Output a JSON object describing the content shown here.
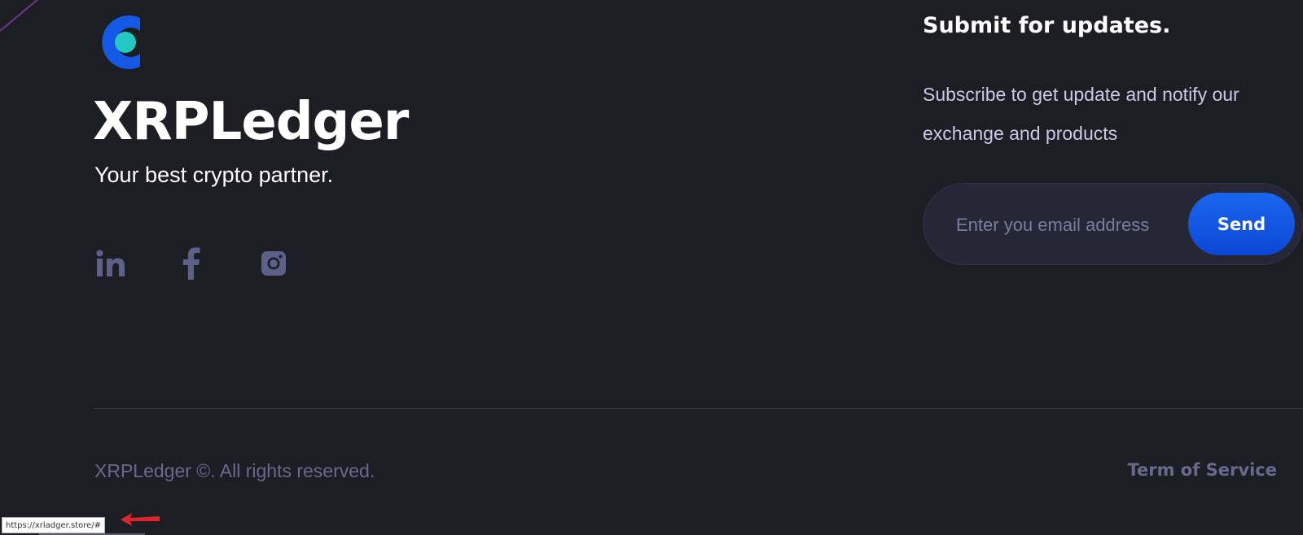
{
  "colors": {
    "background": "#1d1d24",
    "logo_outer": "#1458e6",
    "logo_inner": "#23c9c0",
    "accent_button": "#1a5ee8",
    "social_icon": "#5d6088",
    "muted_text": "#676a8c",
    "annotation_arrow": "#e0242b"
  },
  "brand": {
    "logo_icon": "brand-logo-icon",
    "name": "XRPLedger",
    "tagline": "Your best crypto partner."
  },
  "social": [
    {
      "name": "linkedin",
      "icon": "linkedin-icon"
    },
    {
      "name": "facebook",
      "icon": "facebook-icon"
    },
    {
      "name": "instagram",
      "icon": "instagram-icon"
    }
  ],
  "subscribe": {
    "title": "Submit for updates.",
    "description": "Subscribe to get update and notify our exchange and products",
    "email_placeholder": "Enter you email address",
    "send_label": "Send"
  },
  "footer": {
    "copyright": "XRPLedger ©. All rights reserved.",
    "terms_label": "Term of Service"
  },
  "status_bar": {
    "url": "https://xrladger.store/#"
  }
}
